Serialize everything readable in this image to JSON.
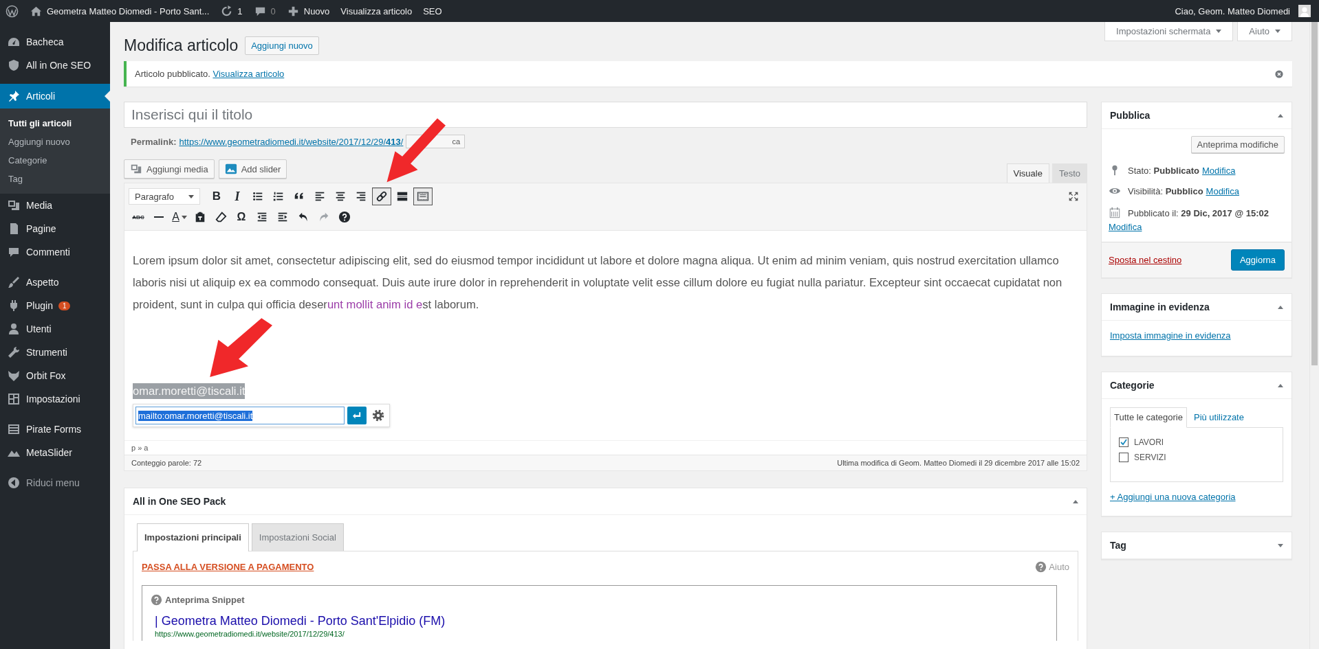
{
  "admin_bar": {
    "site_name": "Geometra Matteo Diomedi - Porto Sant...",
    "updates": "1",
    "comments": "0",
    "new": "Nuovo",
    "view": "Visualizza articolo",
    "seo": "SEO",
    "greeting": "Ciao, Geom. Matteo Diomedi"
  },
  "sidebar": {
    "groups": [
      [
        {
          "label": "Bacheca",
          "selected": false
        },
        {
          "label": "All in One SEO",
          "selected": false
        }
      ],
      [
        {
          "label": "Articoli",
          "selected": true,
          "submenu": [
            {
              "label": "Tutti gli articoli",
              "selected": true
            },
            {
              "label": "Aggiungi nuovo",
              "selected": false
            },
            {
              "label": "Categorie",
              "selected": false
            },
            {
              "label": "Tag",
              "selected": false
            }
          ]
        },
        {
          "label": "Media",
          "selected": false
        },
        {
          "label": "Pagine",
          "selected": false
        },
        {
          "label": "Commenti",
          "selected": false
        }
      ],
      [
        {
          "label": "Aspetto",
          "selected": false
        },
        {
          "label": "Plugin",
          "selected": false,
          "badge": "1"
        },
        {
          "label": "Utenti",
          "selected": false
        },
        {
          "label": "Strumenti",
          "selected": false
        },
        {
          "label": "Orbit Fox",
          "selected": false
        },
        {
          "label": "Impostazioni",
          "selected": false
        }
      ],
      [
        {
          "label": "Pirate Forms",
          "selected": false
        },
        {
          "label": "MetaSlider",
          "selected": false
        }
      ]
    ],
    "collapse": "Riduci menu"
  },
  "screen_meta": [
    "Impostazioni schermata",
    "Aiuto"
  ],
  "page": {
    "title": "Modifica articolo",
    "add_new": "Aggiungi nuovo"
  },
  "notice": {
    "text": "Articolo pubblicato.",
    "link": "Visualizza articolo"
  },
  "title_field": {
    "placeholder": "Inserisci qui il titolo"
  },
  "permalink": {
    "label": "Permalink:",
    "url": "https://www.geometradiomedi.it/website/2017/12/29/**413**/",
    "button": "ca"
  },
  "media_buttons": [
    "Aggiungi media",
    "Add slider"
  ],
  "editor_tabs": [
    {
      "label": "Visuale",
      "selected": true
    },
    {
      "label": "Testo",
      "selected": false
    }
  ],
  "format_select": "Paragrafo",
  "toolbar": {
    "row_1": [
      {
        "kind": "bold",
        "label": "B",
        "pressed": false,
        "disabled": false
      },
      {
        "kind": "italic",
        "label": "I",
        "pressed": false,
        "disabled": false
      },
      {
        "kind": "bullets",
        "pressed": false,
        "disabled": false
      },
      {
        "kind": "numbers",
        "pressed": false,
        "disabled": false
      },
      {
        "kind": "quote",
        "pressed": false,
        "disabled": false
      },
      {
        "kind": "align-left",
        "pressed": false,
        "disabled": false
      },
      {
        "kind": "align-center",
        "pressed": false,
        "disabled": false
      },
      {
        "kind": "align-right",
        "pressed": false,
        "disabled": false
      },
      {
        "kind": "link",
        "pressed": true,
        "disabled": false
      },
      {
        "kind": "more",
        "pressed": false,
        "disabled": false
      },
      {
        "kind": "kitchen-sink",
        "pressed": true,
        "disabled": false
      }
    ],
    "row_2": [
      {
        "kind": "strike",
        "label": "ABC",
        "pressed": false,
        "disabled": false
      },
      {
        "kind": "hr",
        "pressed": false,
        "disabled": false
      },
      {
        "kind": "color",
        "label": "A",
        "pressed": false,
        "disabled": false
      },
      {
        "kind": "paste",
        "pressed": false,
        "disabled": false
      },
      {
        "kind": "eraser",
        "pressed": false,
        "disabled": false
      },
      {
        "kind": "symbol",
        "label": "Ω",
        "pressed": false,
        "disabled": false
      },
      {
        "kind": "outdent",
        "pressed": false,
        "disabled": false
      },
      {
        "kind": "indent",
        "pressed": false,
        "disabled": false
      },
      {
        "kind": "undo",
        "pressed": false,
        "disabled": false
      },
      {
        "kind": "redo",
        "pressed": false,
        "disabled": true
      },
      {
        "kind": "help",
        "pressed": false,
        "disabled": false
      }
    ]
  },
  "content": {
    "paragraph": [
      {
        "text": "Lorem ipsum dolor sit amet, consectetur adipiscing elit, sed do eiusmod tempor incididunt ut labore et dolore magna aliqua. Ut enim ad minim veniam, quis nostrud exercitation ullamco laboris nisi ut aliquip ex ea commodo consequat. Duis aute irure dolor in reprehenderit in voluptate velit esse cillum dolore eu fugiat nulla pariatur. Excepteur sint occaecat cupidatat non proident, sunt in culpa qui officia deser",
        "highlighted": false
      },
      {
        "text": "unt mollit anim id e",
        "highlighted": true
      },
      {
        "text": "st laborum.",
        "highlighted": false
      }
    ],
    "link_text": "omar.moretti@tiscali.it",
    "link_url": "mailto:omar.moretti@tiscali.it"
  },
  "element_path": "p » a",
  "status": {
    "word_count": "Conteggio parole: 72",
    "last_edit": "Ultima modifica di Geom. Matteo Diomedi il 29 dicembre 2017 alle 15:02"
  },
  "seo_box": {
    "title": "All in One SEO Pack",
    "expanded": true,
    "tabs": [
      {
        "label": "Impostazioni principali",
        "selected": true
      },
      {
        "label": "Impostazioni Social",
        "selected": false
      }
    ],
    "upgrade": "PASSA ALLA VERSIONE A PAGAMENTO",
    "help": "Aiuto",
    "snippet": {
      "label": "Anteprima Snippet",
      "title": "| Geometra Matteo Diomedi - Porto Sant'Elpidio (FM)",
      "url": "https://www.geometradiomedi.it/website/2017/12/29/413/"
    }
  },
  "publish_box": {
    "title": "Pubblica",
    "expanded": true,
    "preview": "Anteprima modifiche",
    "rows": [
      {
        "text": "Stato: **Pubblicato**",
        "link": "Modifica"
      },
      {
        "text": "Visibilità: **Pubblico**",
        "link": "Modifica"
      },
      {
        "text": "Pubblicato il: **29 Dic, 2017 @ 15:02**",
        "link": "Modifica"
      }
    ],
    "trash": "Sposta nel cestino",
    "update": "Aggiorna"
  },
  "featured_box": {
    "title": "Immagine in evidenza",
    "expanded": true,
    "link": "Imposta immagine in evidenza"
  },
  "categories_box": {
    "title": "Categorie",
    "expanded": true,
    "tabs": [
      {
        "label": "Tutte le categorie",
        "selected": true
      },
      {
        "label": "Più utilizzate",
        "selected": false
      }
    ],
    "items": [
      {
        "label": "LAVORI",
        "checked": true
      },
      {
        "label": "SERVIZI",
        "checked": false
      }
    ],
    "add": "+ Aggiungi una nuova categoria"
  },
  "tag_box": {
    "title": "Tag",
    "expanded": false
  }
}
